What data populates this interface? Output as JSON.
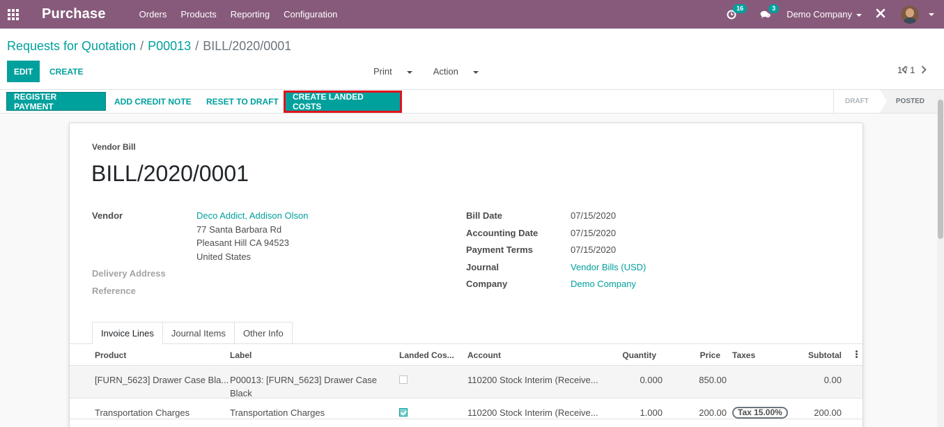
{
  "navbar": {
    "app_title": "Purchase",
    "menu": [
      "Orders",
      "Products",
      "Reporting",
      "Configuration"
    ],
    "activity_count": "16",
    "message_count": "3",
    "company": "Demo Company",
    "icons": [
      "apps-grid-icon",
      "clock-icon",
      "chat-icon",
      "debug-tool-icon",
      "user-avatar"
    ],
    "color": "#875a7b"
  },
  "breadcrumb": {
    "items": [
      "Requests for Quotation",
      "P00013"
    ],
    "current": "BILL/2020/0001"
  },
  "buttons": {
    "edit": "EDIT",
    "create": "CREATE",
    "print": "Print",
    "action": "Action"
  },
  "pager": {
    "value": "1 / 1"
  },
  "statusbar": {
    "register_payment": "REGISTER PAYMENT",
    "add_credit_note": "ADD CREDIT NOTE",
    "reset_to_draft": "RESET TO DRAFT",
    "create_landed_costs": "CREATE LANDED COSTS",
    "stages": [
      "DRAFT",
      "POSTED"
    ],
    "current_stage": "POSTED"
  },
  "form": {
    "doc_type": "Vendor Bill",
    "name": "BILL/2020/0001",
    "vendor_label": "Vendor",
    "vendor": "Deco Addict, Addison Olson",
    "vendor_address": [
      "77 Santa Barbara Rd",
      "Pleasant Hill CA 94523",
      "United States"
    ],
    "delivery_label": "Delivery Address",
    "reference_label": "Reference",
    "bill_date_label": "Bill Date",
    "bill_date": "07/15/2020",
    "accounting_date_label": "Accounting Date",
    "accounting_date": "07/15/2020",
    "payment_terms_label": "Payment Terms",
    "payment_terms": "07/15/2020",
    "journal_label": "Journal",
    "journal": "Vendor Bills (USD)",
    "company_label": "Company",
    "company": "Demo Company"
  },
  "tabs": [
    "Invoice Lines",
    "Journal Items",
    "Other Info"
  ],
  "table": {
    "columns": [
      "Product",
      "Label",
      "Landed Cos...",
      "Account",
      "Quantity",
      "Price",
      "Taxes",
      "Subtotal"
    ],
    "rows": [
      {
        "product": "[FURN_5623] Drawer Case Bla...",
        "label_1": "P00013: [FURN_5623] Drawer Case",
        "label_2": "Black",
        "landed_cost": false,
        "account": "110200 Stock Interim (Receive...",
        "quantity": "0.000",
        "price": "850.00",
        "taxes": "",
        "subtotal": "0.00"
      },
      {
        "product": "Transportation Charges",
        "label_1": "Transportation Charges",
        "label_2": "",
        "landed_cost": true,
        "account": "110200 Stock Interim (Receive...",
        "quantity": "1.000",
        "price": "200.00",
        "taxes": "Tax 15.00%",
        "subtotal": "200.00"
      }
    ]
  },
  "colors": {
    "primary": "#00a09d",
    "navbar": "#875a7b",
    "highlight": "#e0131c"
  }
}
